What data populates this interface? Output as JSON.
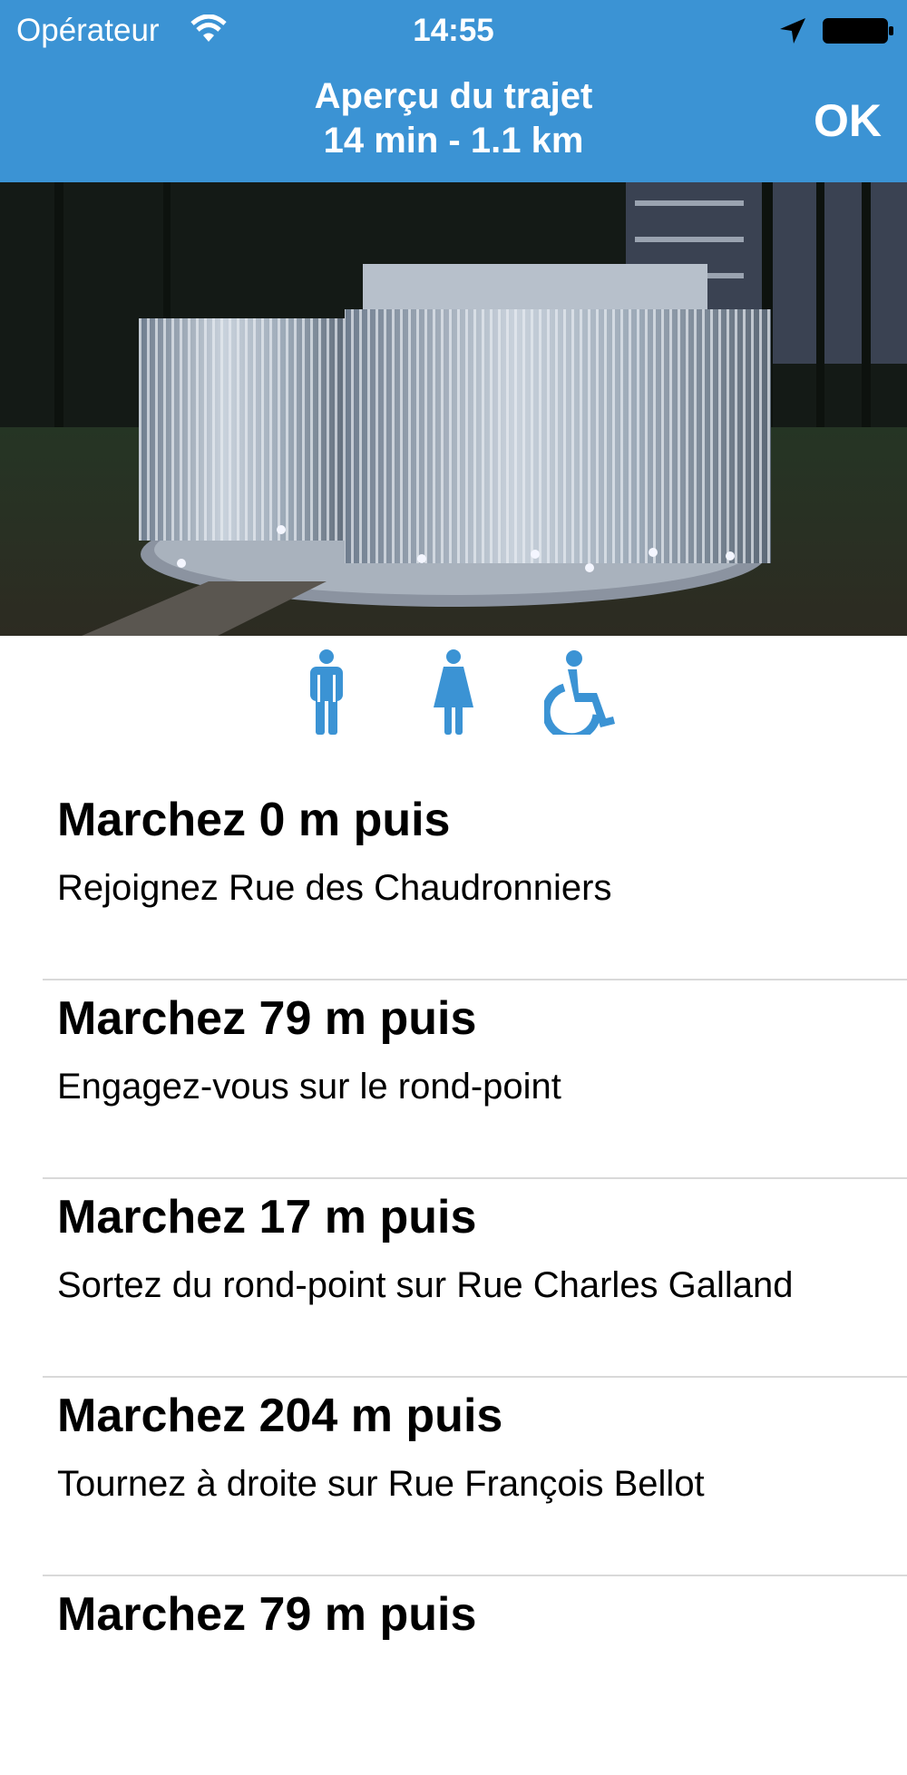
{
  "status_bar": {
    "carrier": "Opérateur",
    "time": "14:55",
    "icons": [
      "wifi-icon",
      "location-arrow-icon",
      "battery-icon"
    ]
  },
  "nav": {
    "title": "Aperçu du trajet",
    "subtitle": "14 min - 1.1 km",
    "ok_label": "OK"
  },
  "colors": {
    "header": "#3b93d4",
    "accent": "#3b93d4"
  },
  "accessibility_icons": [
    "male-icon",
    "female-icon",
    "wheelchair-icon"
  ],
  "steps": [
    {
      "title": "Marchez 0 m puis",
      "description": "Rejoignez Rue des Chaudronniers"
    },
    {
      "title": "Marchez 79 m puis",
      "description": "Engagez-vous sur le rond-point"
    },
    {
      "title": "Marchez 17 m puis",
      "description": "Sortez du rond-point sur Rue Charles Galland"
    },
    {
      "title": "Marchez 204 m puis",
      "description": "Tournez à droite sur Rue François Bellot"
    },
    {
      "title": "Marchez 79 m puis",
      "description": ""
    }
  ]
}
